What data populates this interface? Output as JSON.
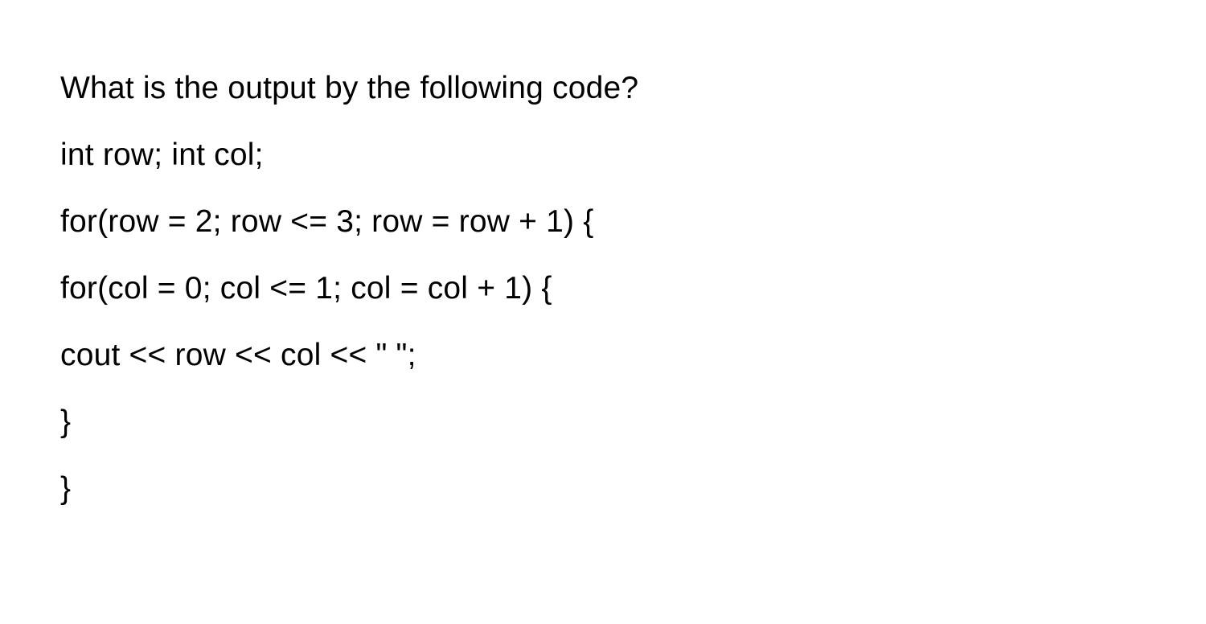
{
  "lines": [
    "What is the output by the following code?",
    "int row; int col;",
    "for(row = 2; row <= 3; row = row + 1) {",
    "for(col = 0; col <= 1; col = col + 1) {",
    "cout << row << col << \" \";",
    "}",
    "}"
  ]
}
